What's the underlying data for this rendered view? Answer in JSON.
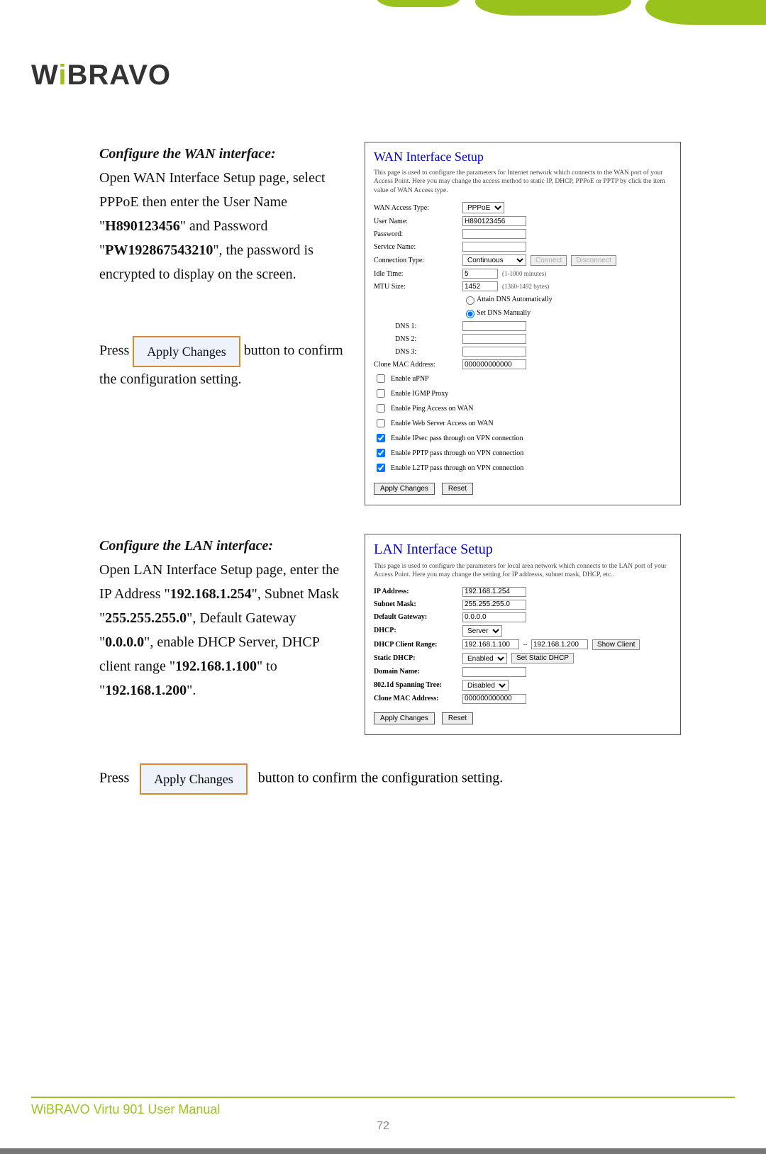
{
  "logo": {
    "text_pre": "W",
    "text_i": "i",
    "text_post": "BRAVO"
  },
  "sectionA": {
    "heading": "Configure the WAN interface:",
    "p1a": "Open WAN Interface Setup page, select PPPoE then enter the User Name \"",
    "p1_user": "H890123456",
    "p1b": "\" and Password \"",
    "p1_pass": "PW192867543210",
    "p1c": "\", the password is encrypted to display on the screen.",
    "press_pre": "Press",
    "apply_label": "Apply Changes",
    "press_post": " button to confirm the configuration setting."
  },
  "wan": {
    "title": "WAN Interface Setup",
    "desc": "This page is used to configure the parameters for Internet network which connects to the WAN port of your Access Point. Here you may change the access method to static IP, DHCP, PPPoE or PPTP by click the item value of WAN Access type.",
    "rows": {
      "access_type_lbl": "WAN Access Type:",
      "access_type_val": "PPPoE",
      "user_lbl": "User Name:",
      "user_val": "H890123456",
      "pass_lbl": "Password:",
      "service_lbl": "Service Name:",
      "conn_lbl": "Connection Type:",
      "conn_val": "Continuous",
      "connect_btn": "Connect",
      "disconnect_btn": "Disconnect",
      "idle_lbl": "Idle Time:",
      "idle_val": "5",
      "idle_hint": "(1-1000 minutes)",
      "mtu_lbl": "MTU Size:",
      "mtu_val": "1452",
      "mtu_hint": "(1360-1492 bytes)",
      "dns_auto": "Attain DNS Automatically",
      "dns_manual": "Set DNS Manually",
      "dns1": "DNS 1:",
      "dns2": "DNS 2:",
      "dns3": "DNS 3:",
      "mac_lbl": "Clone MAC Address:",
      "mac_val": "000000000000"
    },
    "checks": [
      "Enable uPNP",
      "Enable IGMP Proxy",
      "Enable Ping Access on WAN",
      "Enable Web Server Access on WAN",
      "Enable IPsec pass through on VPN connection",
      "Enable PPTP pass through on VPN connection",
      "Enable L2TP pass through on VPN connection"
    ],
    "checked_idx": [
      4,
      5,
      6
    ],
    "apply": "Apply Changes",
    "reset": "Reset"
  },
  "sectionB": {
    "heading": "Configure the LAN interface:",
    "p1a": "Open LAN Interface Setup page, enter the IP Address \"",
    "ip": "192.168.1.254",
    "p1b": "\", Subnet Mask \"",
    "mask": "255.255.255.0",
    "p1c": "\", Default Gateway \"",
    "gw": "0.0.0.0",
    "p1d": "\", enable DHCP Server, DHCP client range \"",
    "r1": "192.168.1.100",
    "p1e": "\" to \"",
    "r2": "192.168.1.200",
    "p1f": "\".",
    "press_pre": "Press",
    "apply_label": "Apply Changes",
    "press_post": " button to confirm the configuration setting."
  },
  "lan": {
    "title": "LAN Interface Setup",
    "desc": "This page is used to configure the parameters for local area network which connects to the LAN port of your Access Point. Here you may change the setting for IP addresss, subnet mask, DHCP, etc..",
    "rows": {
      "ip_lbl": "IP Address:",
      "ip_val": "192.168.1.254",
      "mask_lbl": "Subnet Mask:",
      "mask_val": "255.255.255.0",
      "gw_lbl": "Default Gateway:",
      "gw_val": "0.0.0.0",
      "dhcp_lbl": "DHCP:",
      "dhcp_val": "Server",
      "range_lbl": "DHCP Client Range:",
      "r1": "192.168.1.100",
      "r2": "192.168.1.200",
      "show_client": "Show Client",
      "static_lbl": "Static DHCP:",
      "static_val": "Enabled",
      "static_btn": "Set Static DHCP",
      "domain_lbl": "Domain Name:",
      "span_lbl": "802.1d Spanning Tree:",
      "span_val": "Disabled",
      "mac_lbl": "Clone MAC Address:",
      "mac_val": "000000000000"
    },
    "apply": "Apply Changes",
    "reset": "Reset"
  },
  "footer": {
    "text": "WiBRAVO Virtu 901 User Manual",
    "page": "72"
  }
}
